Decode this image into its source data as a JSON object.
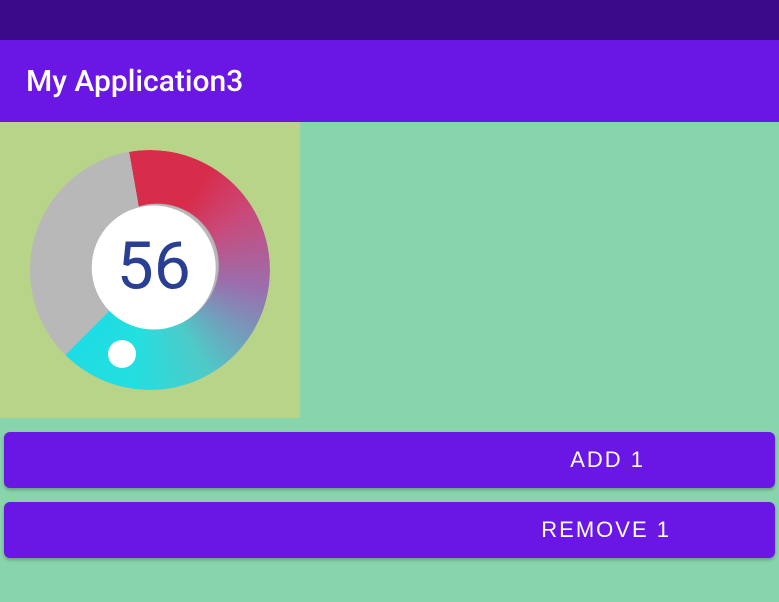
{
  "header": {
    "title": "My Application3"
  },
  "gauge": {
    "value": "56"
  },
  "buttons": {
    "add_label": "ADD 1",
    "remove_label": "REMOVE 1"
  },
  "colors": {
    "status_bar": "#3a0a8b",
    "primary": "#6a16e4",
    "background": "#88d4ac",
    "panel": "#b7d488",
    "gauge_text": "#293f94"
  }
}
